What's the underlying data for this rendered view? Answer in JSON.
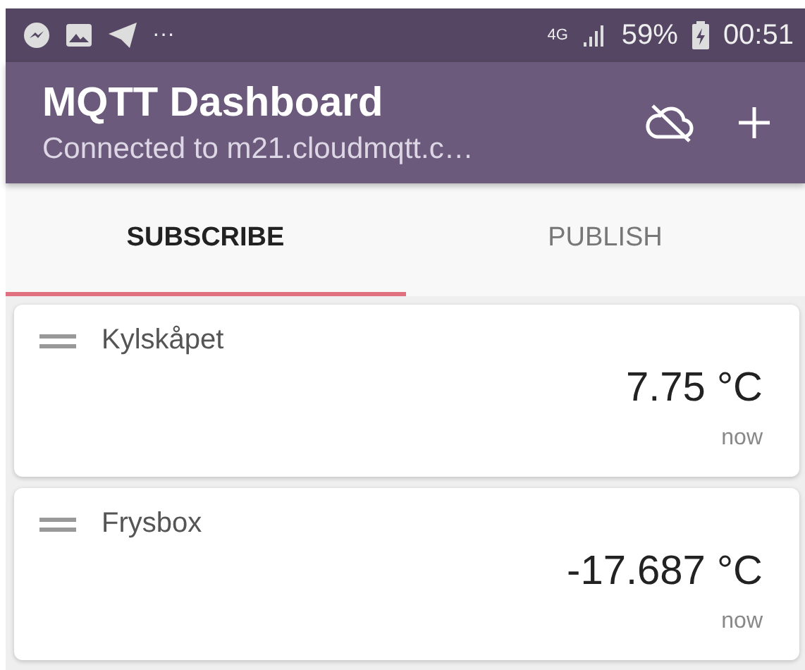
{
  "status_bar": {
    "overflow": "···",
    "network": "4G",
    "battery": "59%",
    "time": "00:51"
  },
  "app_bar": {
    "title": "MQTT Dashboard",
    "subtitle": "Connected to m21.cloudmqtt.c…"
  },
  "tabs": [
    {
      "label": "SUBSCRIBE",
      "selected": true
    },
    {
      "label": "PUBLISH",
      "selected": false
    }
  ],
  "tiles": [
    {
      "name": "Kylskåpet",
      "value": "7.75 °C",
      "time": "now"
    },
    {
      "name": "Frysbox",
      "value": "-17.687 °C",
      "time": "now"
    }
  ]
}
